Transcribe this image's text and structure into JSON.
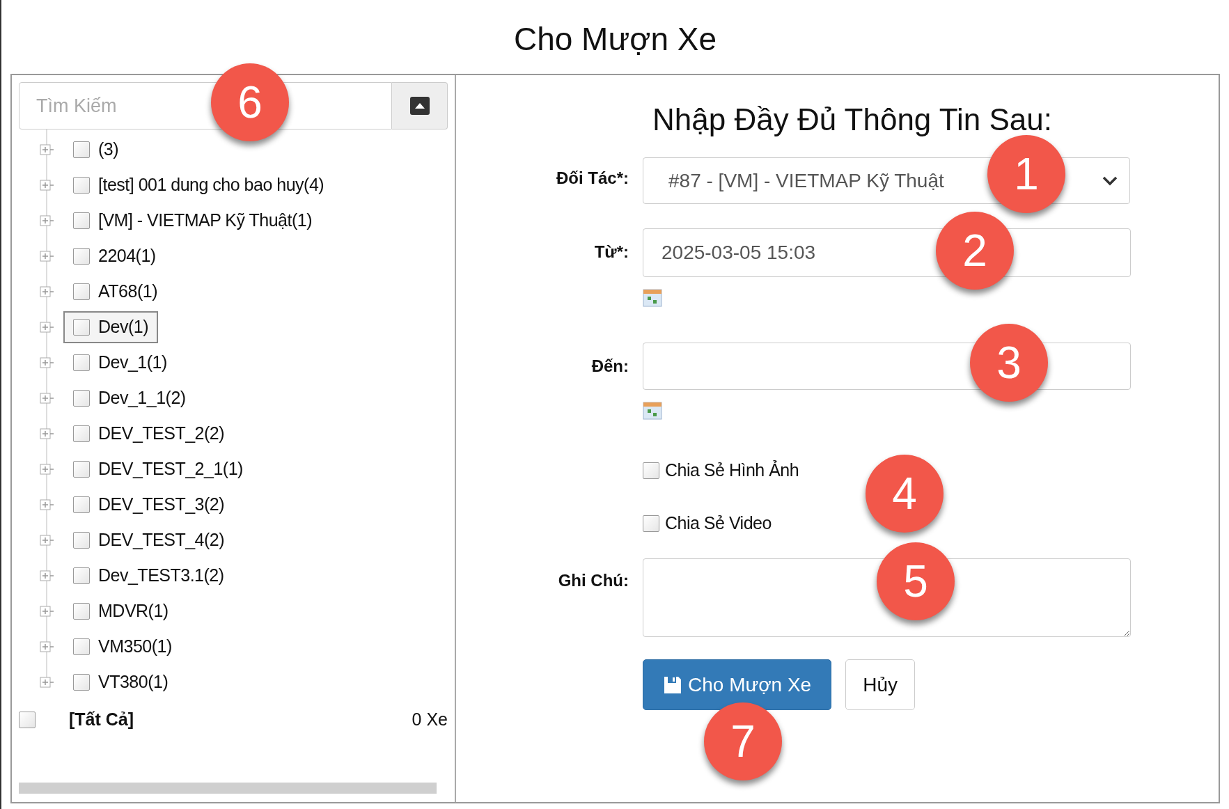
{
  "window": {
    "title": "Cho Mượn Xe"
  },
  "search": {
    "placeholder": "Tìm Kiếm"
  },
  "tree": {
    "items": [
      {
        "label": "(3)",
        "checked": false,
        "selected": false
      },
      {
        "label": "[test] 001 dung cho bao huy(4)",
        "checked": false,
        "selected": false
      },
      {
        "label": "[VM] - VIETMAP Kỹ Thuật(1)",
        "checked": false,
        "selected": false
      },
      {
        "label": "2204(1)",
        "checked": false,
        "selected": false
      },
      {
        "label": "AT68(1)",
        "checked": false,
        "selected": false
      },
      {
        "label": "Dev(1)",
        "checked": false,
        "selected": true
      },
      {
        "label": "Dev_1(1)",
        "checked": false,
        "selected": false
      },
      {
        "label": "Dev_1_1(2)",
        "checked": false,
        "selected": false
      },
      {
        "label": "DEV_TEST_2(2)",
        "checked": false,
        "selected": false
      },
      {
        "label": "DEV_TEST_2_1(1)",
        "checked": false,
        "selected": false
      },
      {
        "label": "DEV_TEST_3(2)",
        "checked": false,
        "selected": false
      },
      {
        "label": "DEV_TEST_4(2)",
        "checked": false,
        "selected": false
      },
      {
        "label": "Dev_TEST3.1(2)",
        "checked": false,
        "selected": false
      },
      {
        "label": "MDVR(1)",
        "checked": false,
        "selected": false
      },
      {
        "label": "VM350(1)",
        "checked": false,
        "selected": false
      },
      {
        "label": "VT380(1)",
        "checked": false,
        "selected": false
      }
    ],
    "all": {
      "label": "[Tất Cả]",
      "checked": false,
      "count": "0 Xe"
    }
  },
  "form": {
    "heading": "Nhập Đầy Đủ Thông Tin Sau:",
    "partner": {
      "label": "Đối Tác*:",
      "value": "#87 - [VM] - VIETMAP Kỹ Thuật"
    },
    "from": {
      "label": "Từ*:",
      "value": "2025-03-05 15:03"
    },
    "to": {
      "label": "Đến:"
    },
    "options": [
      {
        "label": "Chia Sẻ Hình Ảnh",
        "checked": false
      },
      {
        "label": "Chia Sẻ Video",
        "checked": false
      }
    ],
    "note": {
      "label": "Ghi Chú:"
    },
    "buttons": [
      {
        "label": "Cho Mượn Xe",
        "kind": "primary"
      },
      {
        "label": "Hủy",
        "kind": "default"
      }
    ]
  },
  "annotations": [
    "6",
    "1",
    "2",
    "3",
    "4",
    "5",
    "7"
  ]
}
